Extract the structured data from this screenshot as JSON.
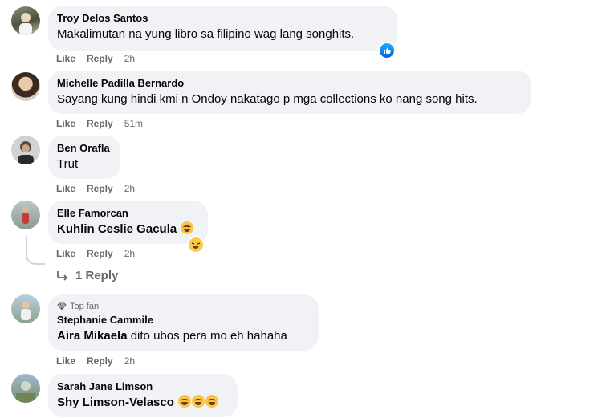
{
  "comments": [
    {
      "name": "Troy Delos Santos",
      "text": "Makalimutan na yung libro sa filipino wag lang songhits.",
      "like": "Like",
      "reply": "Reply",
      "time": "2h",
      "reaction": "like-icon"
    },
    {
      "name": "Michelle Padilla Bernardo",
      "text": "Sayang kung hindi kmi n Ondoy nakatago p mga collections ko nang song hits.",
      "like": "Like",
      "reply": "Reply",
      "time": "51m"
    },
    {
      "name": "Ben Orafla",
      "text": "Trut",
      "like": "Like",
      "reply": "Reply",
      "time": "2h"
    },
    {
      "name": "Elle Famorcan",
      "mention": "Kuhlin Ceslie Gacula",
      "like": "Like",
      "reply": "Reply",
      "time": "2h",
      "reaction": "haha-icon",
      "view_replies": "1 Reply"
    },
    {
      "badge": "Top fan",
      "name": "Stephanie Cammile",
      "mention": "Aira Mikaela",
      "text": " dito ubos pera mo eh hahaha",
      "like": "Like",
      "reply": "Reply",
      "time": "2h"
    },
    {
      "name": "Sarah Jane Limson",
      "mention": "Shy Limson-Velasco",
      "like": "Like",
      "reply": "Reply",
      "time": "2h"
    }
  ],
  "colors": {
    "bubble": "#f0f2f5",
    "secondary_text": "#65676b",
    "like_blue": "#1877f2",
    "haha_yellow": "#f7c548"
  }
}
